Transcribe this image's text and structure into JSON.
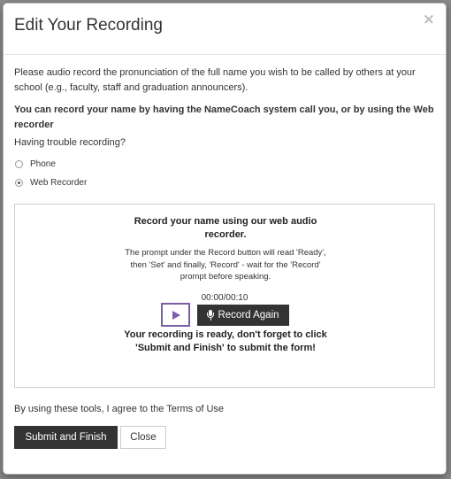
{
  "modal": {
    "title": "Edit Your Recording",
    "close_glyph": "×"
  },
  "body": {
    "intro": "Please audio record the pronunciation of the full name you wish to be called by others at your school (e.g., faculty, staff and graduation announcers).",
    "options_heading": "You can record your name by having the NameCoach system call you, or by using the Web recorder",
    "trouble_text": "Having trouble recording?",
    "radio_options": [
      {
        "label": "Phone",
        "checked": false
      },
      {
        "label": "Web Recorder",
        "checked": true
      }
    ]
  },
  "recorder": {
    "title": "Record your name using our web audio recorder.",
    "prompt": "The prompt under the Record button will read 'Ready', then 'Set' and finally, 'Record' - wait for the 'Record' prompt before speaking.",
    "timer": "00:00/00:10",
    "play_icon": "play-icon",
    "record_label": "Record Again",
    "record_icon": "microphone-icon",
    "ready_message": "Your recording is ready, don't forget to click 'Submit and Finish' to submit the form!"
  },
  "footer": {
    "terms": "By using these tools, I agree to the Terms of Use",
    "submit_label": "Submit and Finish",
    "close_label": "Close"
  },
  "colors": {
    "primary_button": "#333333",
    "play_accent": "#7b5ea7"
  }
}
